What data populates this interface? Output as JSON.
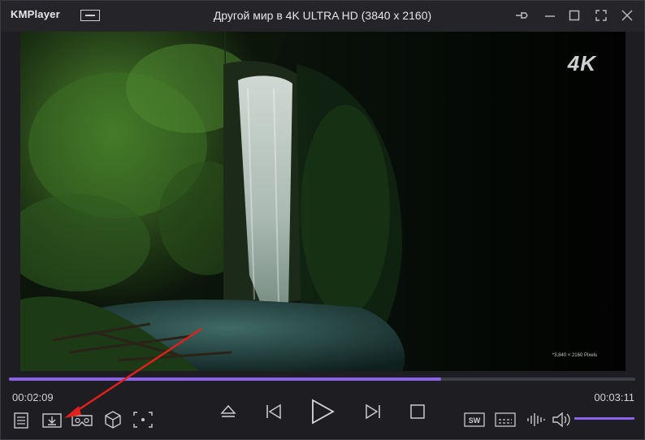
{
  "app": {
    "brand": "KMPlayer",
    "title": "Другой мир в 4K ULTRA HD (3840 x 2160)"
  },
  "video": {
    "badge": "4K",
    "pixel_note": "*3,840 × 2160 Pixels"
  },
  "playback": {
    "current_time": "00:02:09",
    "total_time": "00:03:11",
    "progress": 0.69,
    "volume": 1.0
  },
  "colors": {
    "accent": "#8b63e8",
    "annotation_arrow": "#e0201b"
  },
  "icons": {
    "left_controls": [
      "playlist-icon",
      "download-icon",
      "vr-glasses-icon",
      "3d-cube-icon",
      "capture-icon"
    ],
    "center_controls": [
      "eject-icon",
      "previous-icon",
      "play-icon",
      "next-icon",
      "stop-icon"
    ],
    "right_controls": [
      "subtitle-sw-icon",
      "subtitle-icon",
      "equalizer-icon",
      "volume-icon"
    ]
  }
}
